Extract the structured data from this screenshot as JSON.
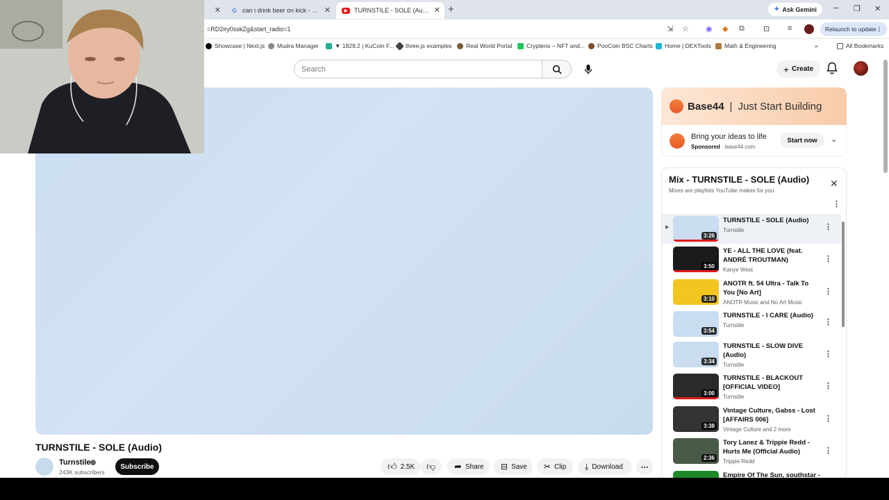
{
  "browser": {
    "tabs": [
      {
        "title": "can i drink beer on kick - Goog",
        "favicon": "G",
        "color": "#4285f4",
        "active": false
      },
      {
        "title": "TURNSTILE - SOLE (Audio) - Yo",
        "favicon": "▶",
        "color": "#e21b1b",
        "active": true
      }
    ],
    "new_tab": "+",
    "gemini_label": "Ask Gemini",
    "url": "=RD2iry0sskZg&start_radio=1",
    "relaunch_label": "Relaunch to update",
    "bookmarks": [
      "Showcase | Next.js",
      "Mudra Manager",
      "▼ 1829.2 | KuCoin F...",
      "three.js examples",
      "Real World Portal",
      "Crypterio – NFT and...",
      "PooCoin BSC Charts",
      "Home | DEXTools",
      "Math & Engineering"
    ],
    "all_bookmarks": "All Bookmarks"
  },
  "header": {
    "search_placeholder": "Search",
    "create_label": "Create"
  },
  "video": {
    "title": "TURNSTILE - SOLE (Audio)",
    "channel": "Turnstile",
    "subscribers": "243K subscribers",
    "subscribe_label": "Subscribe",
    "likes": "2.5K",
    "share_label": "Share",
    "save_label": "Save",
    "clip_label": "Clip",
    "download_label": "Download"
  },
  "ad": {
    "brand": "Base44",
    "separator": "|",
    "tagline": "Just Start Building",
    "headline": "Bring your ideas to life",
    "sponsored": "Sponsored",
    "domain": "base44.com",
    "cta": "Start now"
  },
  "playlist": {
    "title": "Mix - TURNSTILE - SOLE (Audio)",
    "subtitle": "Mixes are playlists YouTube makes for you",
    "items": [
      {
        "title": "TURNSTILE - SOLE (Audio)",
        "channel": "Turnstile",
        "duration": "3:26",
        "thumb": "#c9dcf0",
        "active": true,
        "progress": true
      },
      {
        "title": "YE - ALL THE LOVE (feat. ANDRÉ TROUTMAN)",
        "channel": "Kanye West",
        "duration": "3:50",
        "thumb": "#1a1a1a",
        "active": false,
        "progress": true
      },
      {
        "title": "ANOTR ft. 54 Ultra - Talk To You [No Art]",
        "channel": "ANOTR Music and No Art Music",
        "duration": "3:10",
        "thumb": "#f3c51f",
        "active": false,
        "progress": false
      },
      {
        "title": "TURNSTILE - I CARE (Audio)",
        "channel": "Turnstile",
        "duration": "3:54",
        "thumb": "#c9dcf0",
        "active": false,
        "progress": false
      },
      {
        "title": "TURNSTILE - SLOW DIVE (Audio)",
        "channel": "Turnstile",
        "duration": "3:34",
        "thumb": "#c9dcf0",
        "active": false,
        "progress": false
      },
      {
        "title": "TURNSTILE - BLACKOUT [OFFICIAL VIDEO]",
        "channel": "Turnstile",
        "duration": "3:00",
        "thumb": "#2a2a2a",
        "active": false,
        "progress": true
      },
      {
        "title": "Vintage Culture, Gabss - Lost [AFFAIRS 006]",
        "channel": "Vintage Culture and 2 more",
        "duration": "3:38",
        "thumb": "#333333",
        "active": false,
        "progress": false
      },
      {
        "title": "Tory Lanez & Trippie Redd - Hurts Me (Official Audio)",
        "channel": "Trippie Redd",
        "duration": "2:36",
        "thumb": "#4a5a48",
        "active": false,
        "progress": false
      },
      {
        "title": "Empire Of The Sun, southstar -",
        "channel": "",
        "duration": "",
        "thumb": "#1c8a2a",
        "active": false,
        "progress": false
      }
    ]
  }
}
